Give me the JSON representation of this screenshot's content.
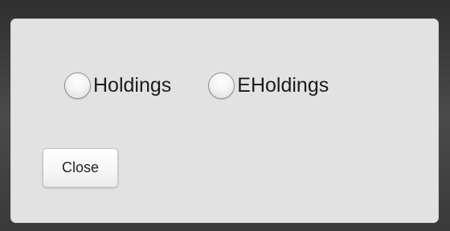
{
  "dialog": {
    "radio_options": [
      {
        "label": "Holdings",
        "selected": false
      },
      {
        "label": "EHoldings",
        "selected": false
      }
    ],
    "close_label": "Close"
  },
  "colors": {
    "backdrop": "#3f3f3f",
    "dialog_background": "#e2e2e2",
    "text": "#1c1c1c"
  }
}
